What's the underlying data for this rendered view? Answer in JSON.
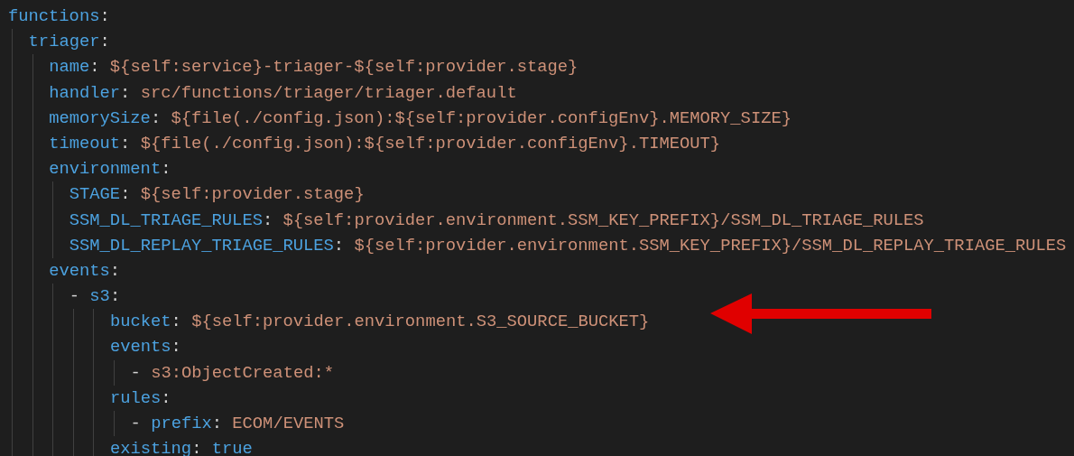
{
  "editor": {
    "lines": [
      {
        "key": "functions",
        "colon": ":",
        "children": [
          {
            "key": "triager",
            "colon": ":",
            "children": [
              {
                "key": "name",
                "colon": ":",
                "value": "${self:service}-triager-${self:provider.stage}"
              },
              {
                "key": "handler",
                "colon": ":",
                "value": "src/functions/triager/triager.default"
              },
              {
                "key": "memorySize",
                "colon": ":",
                "value": "${file(./config.json):${self:provider.configEnv}.MEMORY_SIZE}"
              },
              {
                "key": "timeout",
                "colon": ":",
                "value": "${file(./config.json):${self:provider.configEnv}.TIMEOUT}"
              },
              {
                "key": "environment",
                "colon": ":",
                "children": [
                  {
                    "key": "STAGE",
                    "colon": ":",
                    "value": "${self:provider.stage}"
                  },
                  {
                    "key": "SSM_DL_TRIAGE_RULES",
                    "colon": ":",
                    "value": "${self:provider.environment.SSM_KEY_PREFIX}/SSM_DL_TRIAGE_RULES"
                  },
                  {
                    "key": "SSM_DL_REPLAY_TRIAGE_RULES",
                    "colon": ":",
                    "value": "${self:provider.environment.SSM_KEY_PREFIX}/SSM_DL_REPLAY_TRIAGE_RULES"
                  }
                ]
              },
              {
                "key": "events",
                "colon": ":",
                "children": [
                  {
                    "dash": "-",
                    "key": "s3",
                    "colon": ":",
                    "children": [
                      {
                        "key": "bucket",
                        "colon": ":",
                        "value": "${self:provider.environment.S3_SOURCE_BUCKET}"
                      },
                      {
                        "key": "events",
                        "colon": ":",
                        "children": [
                          {
                            "dash": "-",
                            "value": "s3:ObjectCreated:*"
                          }
                        ]
                      },
                      {
                        "key": "rules",
                        "colon": ":",
                        "children": [
                          {
                            "dash": "-",
                            "key": "prefix",
                            "colon": ":",
                            "value": "ECOM/EVENTS"
                          }
                        ]
                      },
                      {
                        "key": "existing",
                        "colon": ":",
                        "value": "true",
                        "kind": "boolean"
                      }
                    ]
                  }
                ]
              }
            ]
          }
        ]
      }
    ]
  }
}
